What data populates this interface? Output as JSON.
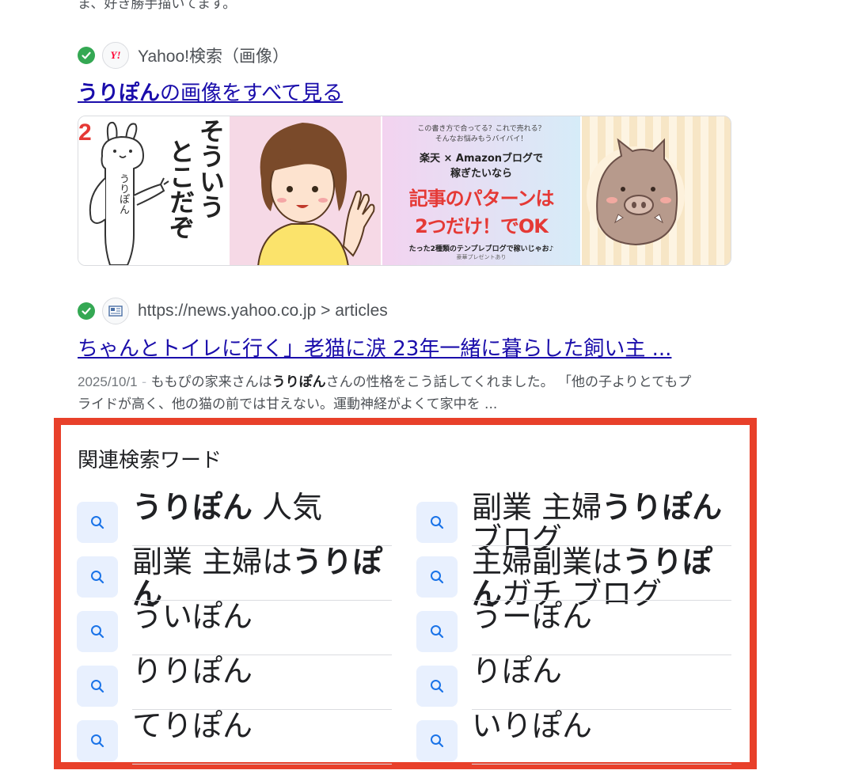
{
  "top_snippet": "ま、好き勝手描いてます。",
  "image_result": {
    "source": "Yahoo!検索（画像）",
    "favicon_text": "Y!",
    "link_bold": "うりぽん",
    "link_rest": "の画像をすべて見る",
    "thumbs": [
      {
        "badge": "2",
        "text_line1": "そういう",
        "text_line2": "とこだぞ",
        "body_text": "うりぽん"
      },
      {},
      {
        "top1": "この書き方で合ってる？これで売れる？",
        "top2": "そんなお悩みもうバイバイ！",
        "mid1": "楽天 × Amazonブログで",
        "mid2": "稼ぎたいなら",
        "big1": "記事のパターンは",
        "big2": "2つだけ！でOK",
        "bottom": "たった2種類のテンプレブログで稼いじゃお♪",
        "tiny": "豪華プレゼントあり"
      },
      {}
    ]
  },
  "news_result": {
    "source": "https://news.yahoo.co.jp > articles",
    "link": "ちゃんとトイレに行く」老猫に涙 23年一緒に暮らした飼い主 ...",
    "date": "2025/10/1",
    "sep": " - ",
    "snippet_pre": "ももぴの家来さんは",
    "snippet_bold": "うりぽん",
    "snippet_post": "さんの性格をこう話してくれました。 「他の子よりとてもプライドが高く、他の猫の前では甘えない。運動神経がよくて家中を ..."
  },
  "related": {
    "title": "関連検索ワード",
    "items": [
      {
        "pre": "",
        "bold": "うりぽん",
        "post": " 人気"
      },
      {
        "pre": "副業 主婦",
        "bold": "うりぽん",
        "post": " ブログ"
      },
      {
        "pre": "副業 主婦は",
        "bold": "うりぽん",
        "post": ""
      },
      {
        "pre": "主婦副業は",
        "bold": "うりぽん",
        "post": "ガチ ブログ"
      },
      {
        "pre": "ういぽん",
        "bold": "",
        "post": ""
      },
      {
        "pre": "うーぽん",
        "bold": "",
        "post": ""
      },
      {
        "pre": "りりぽん",
        "bold": "",
        "post": ""
      },
      {
        "pre": "りぽん",
        "bold": "",
        "post": ""
      },
      {
        "pre": "てりぽん",
        "bold": "",
        "post": ""
      },
      {
        "pre": "いりぽん",
        "bold": "",
        "post": ""
      }
    ]
  },
  "colors": {
    "link": "#1a0dab",
    "highlight_border": "#e8402a",
    "check": "#34a853",
    "icon_bg": "#e8f0fe",
    "icon": "#1a73e8"
  }
}
